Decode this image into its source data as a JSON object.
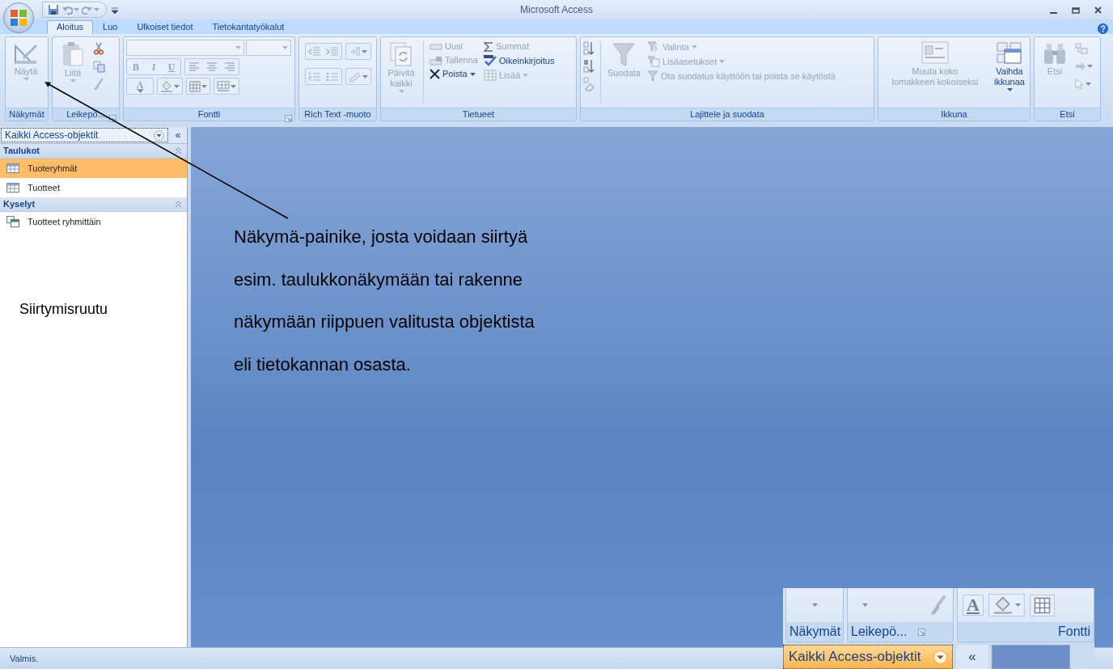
{
  "window": {
    "title": "Microsoft Access"
  },
  "tabs": [
    {
      "label": "Aloitus",
      "selected": true
    },
    {
      "label": "Luo",
      "selected": false
    },
    {
      "label": "Ulkoiset tiedot",
      "selected": false
    },
    {
      "label": "Tietokantatyökalut",
      "selected": false
    }
  ],
  "ribbon": {
    "groups": [
      {
        "label": "Näkymät",
        "launcher": false,
        "buttons": [
          {
            "kind": "large",
            "label": "Näytä",
            "disabled": true,
            "dropdown": true
          }
        ]
      },
      {
        "label": "Leikepö...",
        "launcher": true,
        "buttons": [
          {
            "kind": "large",
            "label": "Liitä",
            "disabled": true,
            "dropdown": true
          }
        ]
      },
      {
        "label": "Fontti",
        "launcher": true,
        "buttons": [
          {
            "kind": "glyph",
            "label": "B",
            "disabled": true
          },
          {
            "kind": "glyph",
            "label": "I",
            "disabled": true
          },
          {
            "kind": "glyph",
            "label": "U",
            "disabled": true
          },
          {
            "kind": "glyph",
            "label": "A",
            "disabled": true,
            "dropdown": true
          }
        ]
      },
      {
        "label": "Rich Text -muoto",
        "launcher": false
      },
      {
        "label": "Tietueet",
        "launcher": false,
        "buttons": [
          {
            "kind": "large",
            "label": "Päivitä\nkaikki",
            "disabled": true,
            "dropdown": true
          },
          {
            "kind": "small",
            "label": "Uusi",
            "disabled": true,
            "dropdown": false
          },
          {
            "kind": "small",
            "label": "Tallenna",
            "disabled": true,
            "dropdown": false
          },
          {
            "kind": "small",
            "label": "Poista",
            "disabled": false,
            "dropdown": true
          },
          {
            "kind": "small",
            "label": "Summat",
            "disabled": true,
            "dropdown": false
          },
          {
            "kind": "small",
            "label": "Oikeinkirjoitus",
            "disabled": false,
            "dropdown": false
          },
          {
            "kind": "small",
            "label": "Lisää",
            "disabled": true,
            "dropdown": true
          }
        ]
      },
      {
        "label": "Lajittele ja suodata",
        "launcher": false,
        "buttons": [
          {
            "kind": "large",
            "label": "Suodata",
            "disabled": true,
            "dropdown": false
          },
          {
            "kind": "small",
            "label": "Valinta",
            "disabled": true,
            "dropdown": true
          },
          {
            "kind": "small",
            "label": "Lisäasetukset",
            "disabled": true,
            "dropdown": true
          },
          {
            "kind": "small",
            "label": "Ota suodatus käyttöön tai poista se käytöstä",
            "disabled": true,
            "dropdown": false
          }
        ]
      },
      {
        "label": "Ikkuna",
        "launcher": false,
        "buttons": [
          {
            "kind": "large",
            "label": "Muuta koko\nlomakkeen kokoiseksi",
            "disabled": true,
            "dropdown": false
          },
          {
            "kind": "large",
            "label": "Vaihda\nikkunaa",
            "disabled": false,
            "dropdown": true
          }
        ]
      },
      {
        "label": "Etsi",
        "launcher": false,
        "buttons": [
          {
            "kind": "large",
            "label": "Etsi",
            "disabled": true,
            "dropdown": false
          }
        ]
      }
    ]
  },
  "navigation_pane": {
    "header": "Kaikki Access-objektit",
    "collapse_glyph": "«",
    "sections": [
      {
        "title": "Taulukot",
        "kind": "tables",
        "expanded": true,
        "items": [
          {
            "label": "Tuoteryhmät",
            "selected": true
          },
          {
            "label": "Tuotteet",
            "selected": false
          }
        ]
      },
      {
        "title": "Kyselyt",
        "kind": "queries",
        "expanded": true,
        "items": [
          {
            "label": "Tuotteet ryhmittäin",
            "selected": false
          }
        ]
      }
    ]
  },
  "annotations": {
    "pane_caption": "Siirtymisruutu",
    "callout": "Näkymä-painike, josta voidaan siirtyä\nesim. taulukkonäkymään tai rakenne\nnäkymään riippuen valitusta objektista\neli tietokannan osasta."
  },
  "status_bar": {
    "text": "Valmis."
  },
  "inset": {
    "group_labels": [
      "Näkymät",
      "Leikepö...",
      "Fontti"
    ],
    "font_color_glyph": "A",
    "nav_header": "Kaikki Access-objektit",
    "collapse_glyph": "«"
  }
}
